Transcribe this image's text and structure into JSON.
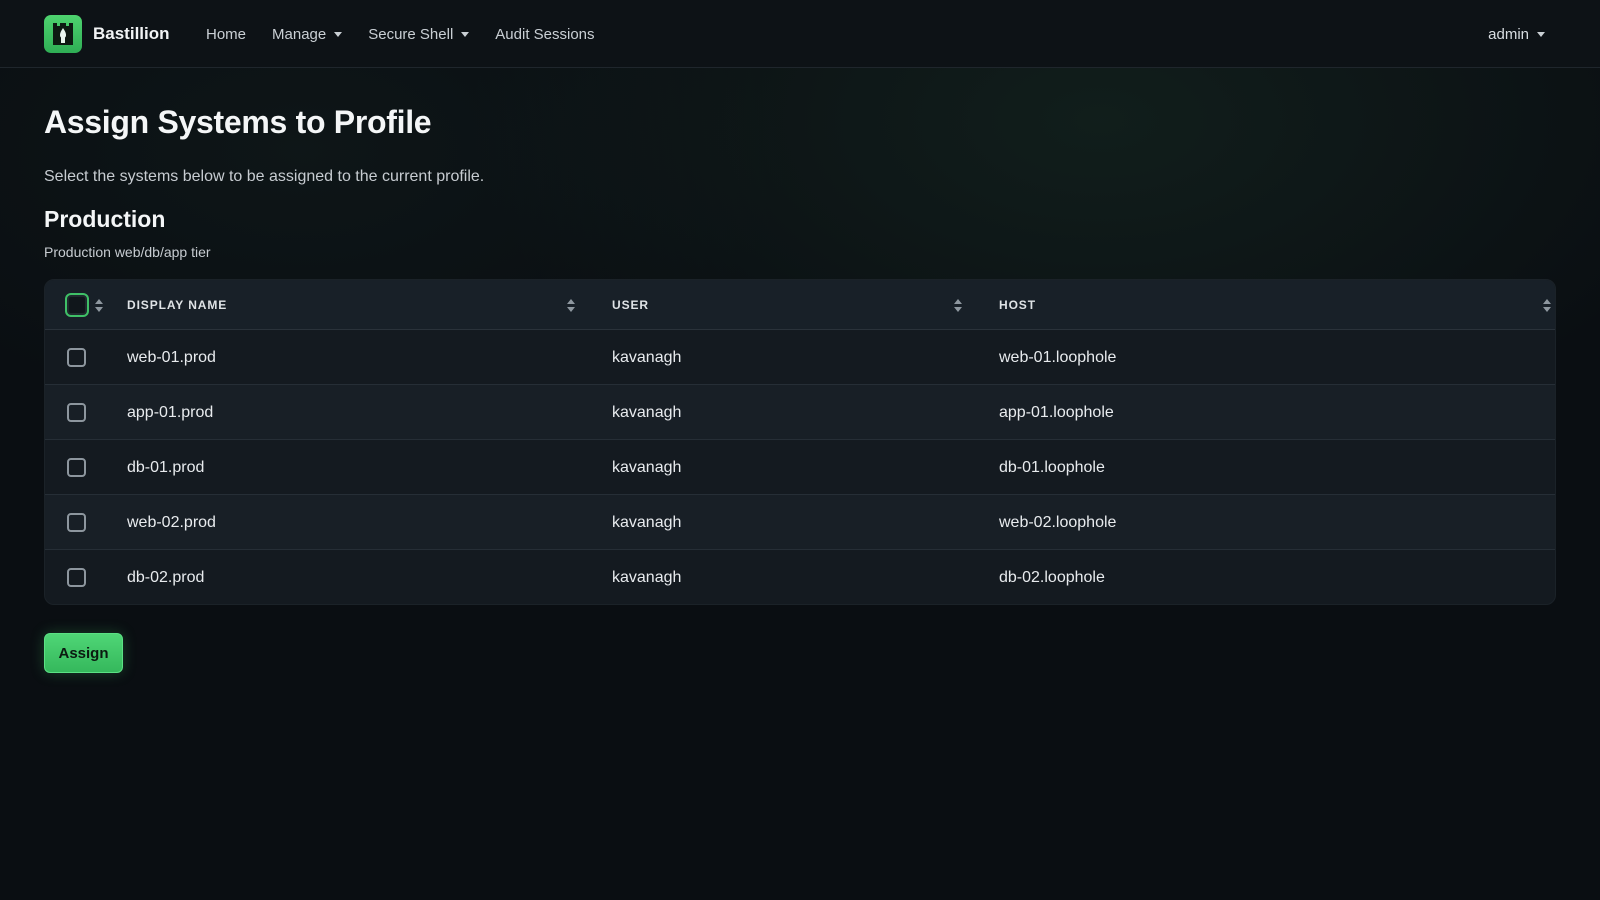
{
  "brand": {
    "name": "Bastillion"
  },
  "nav": {
    "items": [
      {
        "label": "Home",
        "dropdown": false
      },
      {
        "label": "Manage",
        "dropdown": true
      },
      {
        "label": "Secure Shell",
        "dropdown": true
      },
      {
        "label": "Audit Sessions",
        "dropdown": false
      }
    ],
    "user": "admin"
  },
  "page": {
    "title": "Assign Systems to Profile",
    "description": "Select the systems below to be assigned to the current profile."
  },
  "profile": {
    "name": "Production",
    "description": "Production web/db/app tier"
  },
  "table": {
    "headers": {
      "display_name": "DISPLAY NAME",
      "user": "USER",
      "host": "HOST"
    },
    "rows": [
      {
        "display_name": "web-01.prod",
        "user": "kavanagh",
        "host": "web-01.loophole",
        "checked": false
      },
      {
        "display_name": "app-01.prod",
        "user": "kavanagh",
        "host": "app-01.loophole",
        "checked": false
      },
      {
        "display_name": "db-01.prod",
        "user": "kavanagh",
        "host": "db-01.loophole",
        "checked": false
      },
      {
        "display_name": "web-02.prod",
        "user": "kavanagh",
        "host": "web-02.loophole",
        "checked": false
      },
      {
        "display_name": "db-02.prod",
        "user": "kavanagh",
        "host": "db-02.loophole",
        "checked": false
      }
    ]
  },
  "actions": {
    "assign_label": "Assign"
  },
  "colors": {
    "accent": "#3fc067",
    "background": "#0a0e12",
    "table_bg": "#141a20"
  },
  "icons": {
    "logo": "castle-icon",
    "sort": "sort-icon",
    "caret": "chevron-down-icon"
  }
}
